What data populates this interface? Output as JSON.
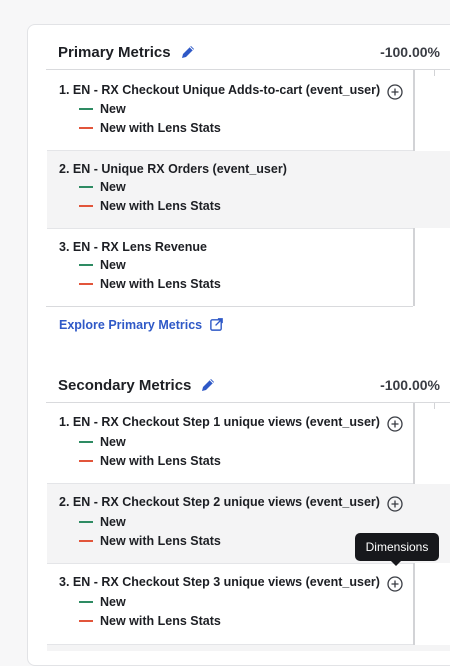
{
  "primary": {
    "title": "Primary Metrics",
    "percent": "-100.00%",
    "explore_label": "Explore Primary Metrics",
    "metrics": [
      {
        "num": "1.",
        "name": "EN - RX Checkout Unique Adds-to-cart (event_user)"
      },
      {
        "num": "2.",
        "name": "EN - Unique RX Orders (event_user)"
      },
      {
        "num": "3.",
        "name": "EN - RX Lens Revenue"
      }
    ]
  },
  "secondary": {
    "title": "Secondary Metrics",
    "percent": "-100.00%",
    "metrics": [
      {
        "num": "1.",
        "name": "EN - RX Checkout Step 1 unique views (event_user)"
      },
      {
        "num": "2.",
        "name": "EN - RX Checkout Step 2 unique views (event_user)"
      },
      {
        "num": "3.",
        "name": "EN - RX Checkout Step 3 unique views (event_user)"
      }
    ]
  },
  "series": {
    "a": {
      "label": "New",
      "color": "#2e8b63"
    },
    "b": {
      "label": "New with Lens Stats",
      "color": "#e2553b"
    }
  },
  "tooltip": {
    "label": "Dimensions"
  },
  "icons": {
    "edit": "pencil-icon",
    "add": "plus-circle-icon",
    "external": "external-link-icon"
  },
  "colors": {
    "accent": "#2f59c7"
  }
}
